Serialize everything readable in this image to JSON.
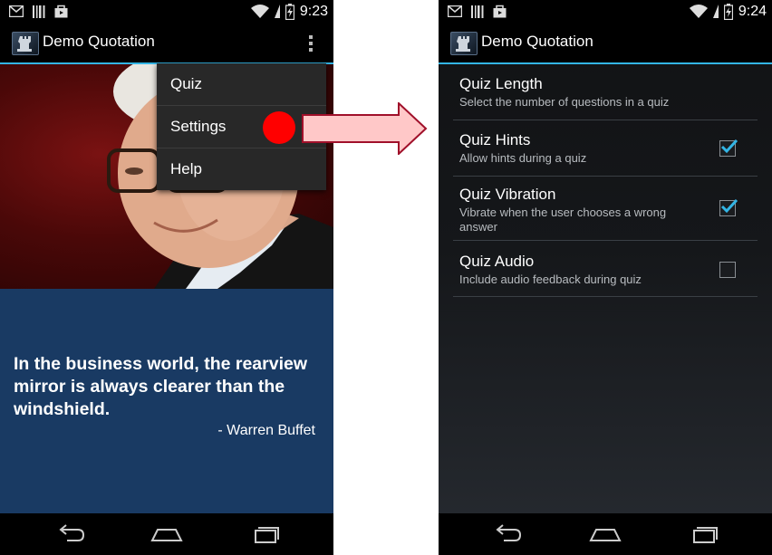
{
  "left": {
    "status": {
      "time": "9:23"
    },
    "app_title": "Demo Quotation",
    "menu": {
      "items": [
        "Quiz",
        "Settings",
        "Help"
      ]
    },
    "quote": {
      "text": "In the business world, the rearview mirror is always clearer than the windshield.",
      "author": "- Warren Buffet"
    }
  },
  "right": {
    "status": {
      "time": "9:24"
    },
    "app_title": "Demo Quotation",
    "settings": [
      {
        "title": "Quiz Length",
        "summary": "Select the number of questions in a quiz"
      },
      {
        "title": "Quiz Hints",
        "summary": "Allow hints during a quiz",
        "checked": true
      },
      {
        "title": "Quiz Vibration",
        "summary": "Vibrate when the user chooses a wrong answer",
        "checked": true
      },
      {
        "title": "Quiz Audio",
        "summary": "Include audio feedback during quiz",
        "checked": false
      }
    ]
  },
  "colors": {
    "accent": "#33b5e5",
    "quote_panel": "#193a63",
    "click_marker": "#ff0000",
    "arrow_fill": "#ffc8c8",
    "arrow_stroke": "#a0102a"
  },
  "icons": [
    "gmail-icon",
    "barcode-icon",
    "shopping-bag-icon",
    "wifi-icon",
    "battery-charging-icon",
    "signal-icon",
    "overflow-menu-icon",
    "back-icon",
    "home-icon",
    "recent-apps-icon",
    "checkbox-icon"
  ]
}
